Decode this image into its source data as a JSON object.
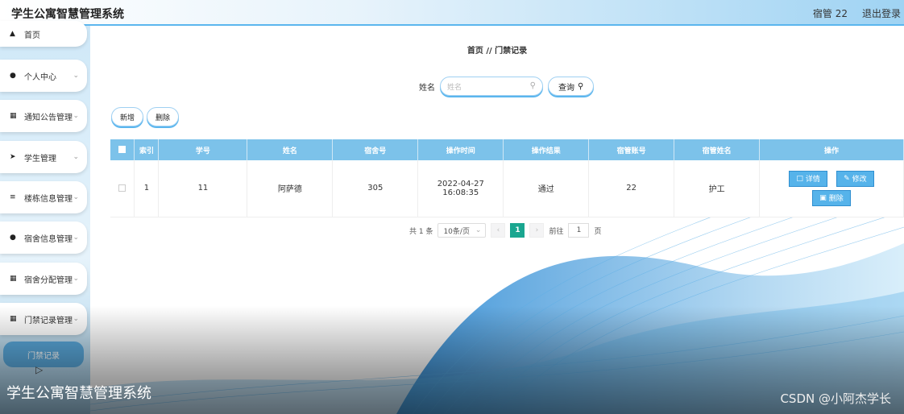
{
  "header": {
    "title": "学生公寓智慧管理系统",
    "user": "宿管 22",
    "logout": "退出登录"
  },
  "sidebar": {
    "items": [
      {
        "label": "首页",
        "icon": "home-icon"
      },
      {
        "label": "个人中心",
        "icon": "user-icon"
      },
      {
        "label": "通知公告管理",
        "icon": "grid-icon"
      },
      {
        "label": "学生管理",
        "icon": "send-icon"
      },
      {
        "label": "楼栋信息管理",
        "icon": "sliders-icon"
      },
      {
        "label": "宿舍信息管理",
        "icon": "user-icon"
      },
      {
        "label": "宿舍分配管理",
        "icon": "grid-icon"
      },
      {
        "label": "门禁记录管理",
        "icon": "grid-icon"
      }
    ],
    "active_sub": "门禁记录"
  },
  "breadcrumb": "首页 // 门禁记录",
  "search": {
    "label": "姓名",
    "placeholder": "姓名",
    "button": "查询"
  },
  "toolbar": {
    "add": "新增",
    "delete": "删除"
  },
  "table": {
    "headers": [
      "索引",
      "学号",
      "姓名",
      "宿舍号",
      "操作时间",
      "操作结果",
      "宿管账号",
      "宿管姓名",
      "操作"
    ],
    "rows": [
      {
        "index": "1",
        "student_no": "11",
        "name": "阿萨德",
        "room": "305",
        "time": "2022-04-27 16:08:35",
        "result": "通过",
        "admin_account": "22",
        "admin_name": "护工"
      }
    ],
    "ops": {
      "detail": "详情",
      "edit": "修改",
      "delete": "删除"
    }
  },
  "pagination": {
    "total": "共 1 条",
    "page_size": "10条/页",
    "current": "1",
    "goto_label": "前往",
    "goto_value": "1",
    "page_suffix": "页"
  },
  "overlay": {
    "caption": "学生公寓智慧管理系统",
    "watermark": "CSDN @小阿杰学长"
  },
  "colors": {
    "accent": "#5bb6ee",
    "header_row": "#7cc2ea",
    "active_page": "#1aa690",
    "sidebar_active": "#5aa9dc"
  }
}
